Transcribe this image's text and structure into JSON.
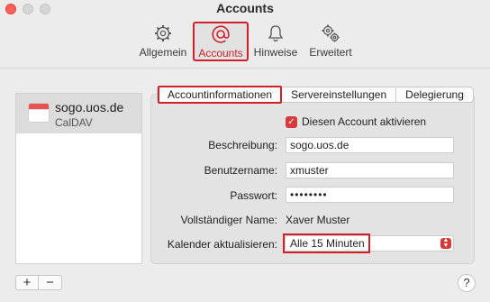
{
  "window": {
    "title": "Accounts"
  },
  "toolbar": {
    "items": [
      {
        "label": "Allgemein",
        "icon": "gear-icon"
      },
      {
        "label": "Accounts",
        "icon": "at-sign-icon",
        "selected": true
      },
      {
        "label": "Hinweise",
        "icon": "bell-icon"
      },
      {
        "label": "Erweitert",
        "icon": "gears-icon"
      }
    ]
  },
  "accounts": [
    {
      "name": "sogo.uos.de",
      "type": "CalDAV",
      "icon": "calendar-icon",
      "selected": true
    }
  ],
  "list_controls": {
    "add": "+",
    "remove": "−"
  },
  "tabs": [
    {
      "label": "Accountinformationen",
      "active": true
    },
    {
      "label": "Servereinstellungen",
      "active": false
    },
    {
      "label": "Delegierung",
      "active": false
    }
  ],
  "form": {
    "enable_account": {
      "label": "Diesen Account aktivieren",
      "checked": true
    },
    "description": {
      "label": "Beschreibung:",
      "value": "sogo.uos.de"
    },
    "username": {
      "label": "Benutzername:",
      "value": "xmuster"
    },
    "password": {
      "label": "Passwort:",
      "value": "••••••••"
    },
    "full_name": {
      "label": "Vollständiger Name:",
      "value": "Xaver Muster"
    },
    "refresh": {
      "label": "Kalender aktualisieren:",
      "value": "Alle 15 Minuten"
    }
  },
  "help": "?",
  "colors": {
    "highlight": "#d0202a",
    "accent": "#d63a3a"
  }
}
